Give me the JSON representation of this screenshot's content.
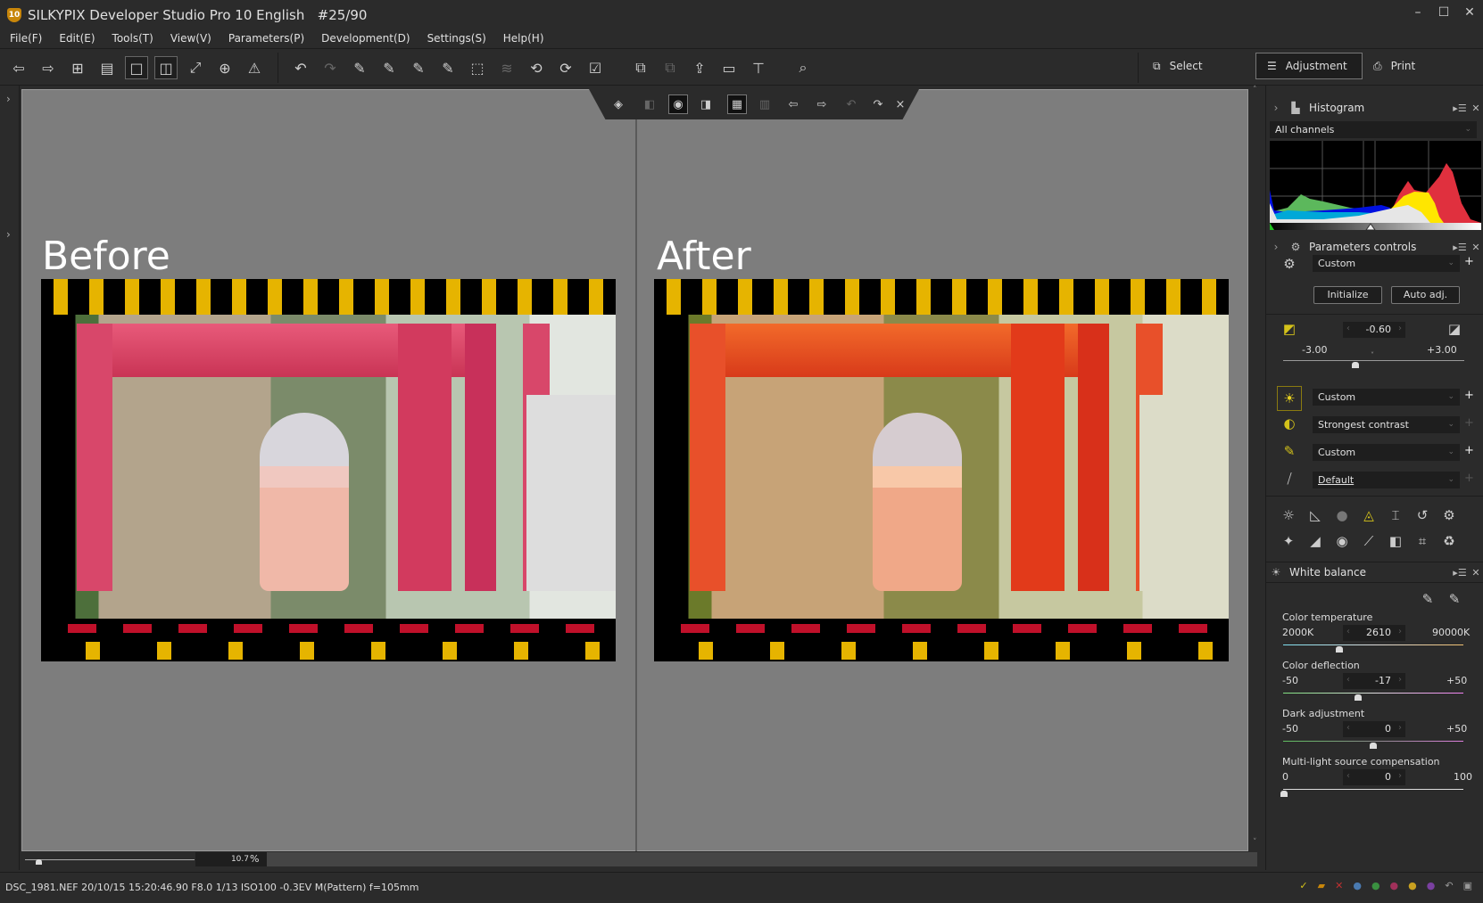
{
  "window": {
    "app_badge": "10",
    "title": "SILKYPIX Developer Studio Pro 10 English   #25/90",
    "minimize": "–",
    "maximize": "☐",
    "close": "✕"
  },
  "menu": [
    "File(F)",
    "Edit(E)",
    "Tools(T)",
    "View(V)",
    "Parameters(P)",
    "Development(D)",
    "Settings(S)",
    "Help(H)"
  ],
  "modes": {
    "select": "Select",
    "adjustment": "Adjustment",
    "print": "Print",
    "active": "Adjustment"
  },
  "viewer": {
    "before_label": "Before",
    "after_label": "After"
  },
  "zoom": {
    "value": "10.7",
    "unit": "%"
  },
  "status": {
    "text": "DSC_1981.NEF 20/10/15 15:20:46.90 F8.0 1/13 ISO100 -0.3EV M(Pattern) f=105mm"
  },
  "histogram": {
    "title": "Histogram",
    "channel": "All channels"
  },
  "params": {
    "title": "Parameters controls",
    "preset": "Custom",
    "initialize": "Initialize",
    "auto_adj": "Auto adj.",
    "exposure": {
      "value": "-0.60",
      "min": "-3.00",
      "max": "+3.00",
      "level": -0.6
    },
    "white_balance_preset": "Custom",
    "tone": "Strongest contrast",
    "sharpness": "Custom",
    "color": "Default"
  },
  "white_balance": {
    "title": "White balance",
    "color_temperature": {
      "label": "Color temperature",
      "min": "2000K",
      "max": "90000K",
      "value": "2610"
    },
    "color_deflection": {
      "label": "Color deflection",
      "min": "-50",
      "max": "+50",
      "value": "-17"
    },
    "dark_adjustment": {
      "label": "Dark adjustment",
      "min": "-50",
      "max": "+50",
      "value": "0"
    },
    "multi_light": {
      "label": "Multi-light source compensation",
      "min": "0",
      "max": "100",
      "value": "0"
    }
  },
  "colors": {
    "accent": "#d4c21a",
    "background": "#2b2b2b",
    "viewer": "#7d7d7d"
  }
}
